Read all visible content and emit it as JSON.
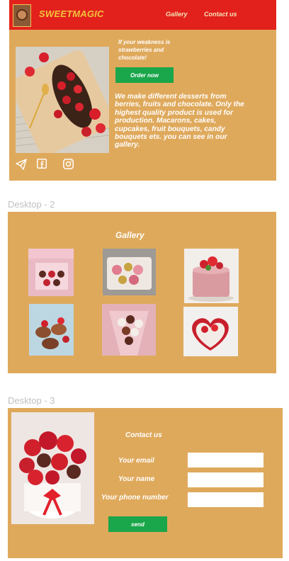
{
  "desktop1": {
    "brand": "SWEETMAGIC",
    "nav": [
      "Gallery",
      "Contact us"
    ],
    "tagline": "If your weakness is strawberries and chocolate!",
    "order_button": "Order now",
    "description": "We make different desserts from berries, fruits and chocolate. Only the highest quality product is used for production. Macarons, cakes, cupcakes, fruit bouquets, candy bouquets ets. you can see in our gallery.",
    "social_icons": [
      "telegram-icon",
      "facebook-icon",
      "instagram-icon"
    ]
  },
  "desktop2": {
    "frame_label": "Desktop - 2",
    "title": "Gallery"
  },
  "desktop3": {
    "frame_label": "Desktop - 3",
    "title": "Contact us",
    "fields": [
      "Your email",
      "Your name",
      "Your phone number"
    ],
    "send_button": "send"
  },
  "colors": {
    "frame": "#dfa95c",
    "navbar": "#e3211c",
    "brand": "#f2c33c",
    "button": "#1aa64a"
  }
}
